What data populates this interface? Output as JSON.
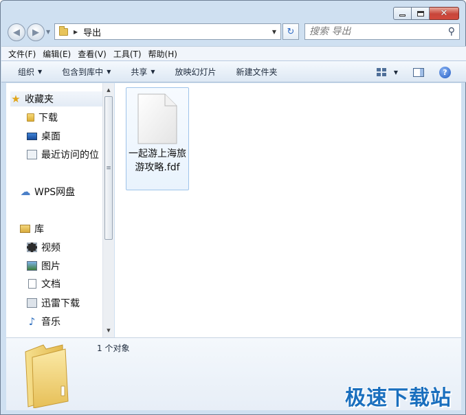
{
  "address": {
    "path": "导出"
  },
  "search": {
    "placeholder": "搜索 导出"
  },
  "menu": [
    "文件(F)",
    "编辑(E)",
    "查看(V)",
    "工具(T)",
    "帮助(H)"
  ],
  "commands": {
    "organize": "组织",
    "include_library": "包含到库中",
    "share": "共享",
    "slideshow": "放映幻灯片",
    "new_folder": "新建文件夹"
  },
  "nav": {
    "favorites": "收藏夹",
    "downloads": "下载",
    "desktop": "桌面",
    "recent": "最近访问的位",
    "wps": "WPS网盘",
    "library": "库",
    "videos": "视频",
    "pictures": "图片",
    "documents": "文档",
    "xunlei": "迅雷下载",
    "music": "音乐"
  },
  "files": [
    {
      "name": "一起游上海旅游攻略.fdf"
    }
  ],
  "status": {
    "count": "1 个对象"
  },
  "watermark": "极速下载站",
  "colors": {
    "accent": "#1a6fbe",
    "window_frame": "#cfe0f1",
    "selection": "#e9f3fd"
  }
}
